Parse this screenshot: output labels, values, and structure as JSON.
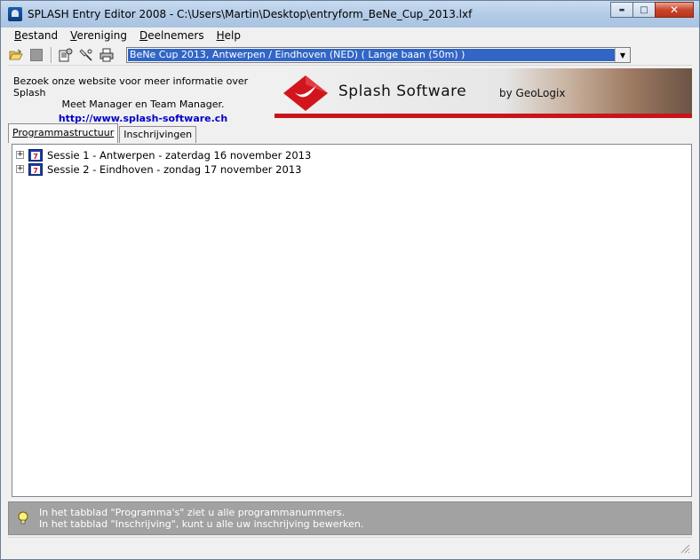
{
  "window": {
    "title": "SPLASH Entry Editor 2008 - C:\\Users\\Martin\\Desktop\\entryform_BeNe_Cup_2013.lxf",
    "minimize_glyph": "▬",
    "maximize_glyph": "□",
    "close_glyph": "✕"
  },
  "menu": {
    "items": [
      {
        "first": "B",
        "rest": "estand"
      },
      {
        "first": "V",
        "rest": "ereniging"
      },
      {
        "first": "D",
        "rest": "eelnemers"
      },
      {
        "first": "H",
        "rest": "elp"
      }
    ]
  },
  "toolbar": {
    "icons": [
      "open-folder-icon",
      "save-icon",
      "properties-icon",
      "tools-icon",
      "print-icon"
    ],
    "meet_selected": "BeNe Cup 2013,  Antwerpen / Eindhoven  (NED)   ( Lange baan (50m) )",
    "dropdown_glyph": "▼"
  },
  "banner": {
    "info_line1": "Bezoek onze website voor meer informatie over Splash",
    "info_line2": "Meet Manager en Team Manager.",
    "link": "http://www.splash-software.ch",
    "logo_name": "Splash Software",
    "logo_by": "by GeoLogix",
    "colors": {
      "brand_red": "#c9141b",
      "link_blue": "#0000c8"
    }
  },
  "tabs": [
    {
      "label": "Programmastructuur",
      "active": true
    },
    {
      "label": "Inschrijvingen",
      "active": false
    }
  ],
  "tree": {
    "sessions": [
      {
        "expander": "+",
        "label": "Sessie 1 - Antwerpen - zaterdag 16 november 2013"
      },
      {
        "expander": "+",
        "label": "Sessie 2 - Eindhoven - zondag 17 november 2013"
      }
    ]
  },
  "hint": {
    "line1": "In het tabblad \"Programma's\" ziet u alle programmanummers.",
    "line2": "In het tabblad \"Inschrijving\", kunt u alle uw inschrijving bewerken."
  }
}
